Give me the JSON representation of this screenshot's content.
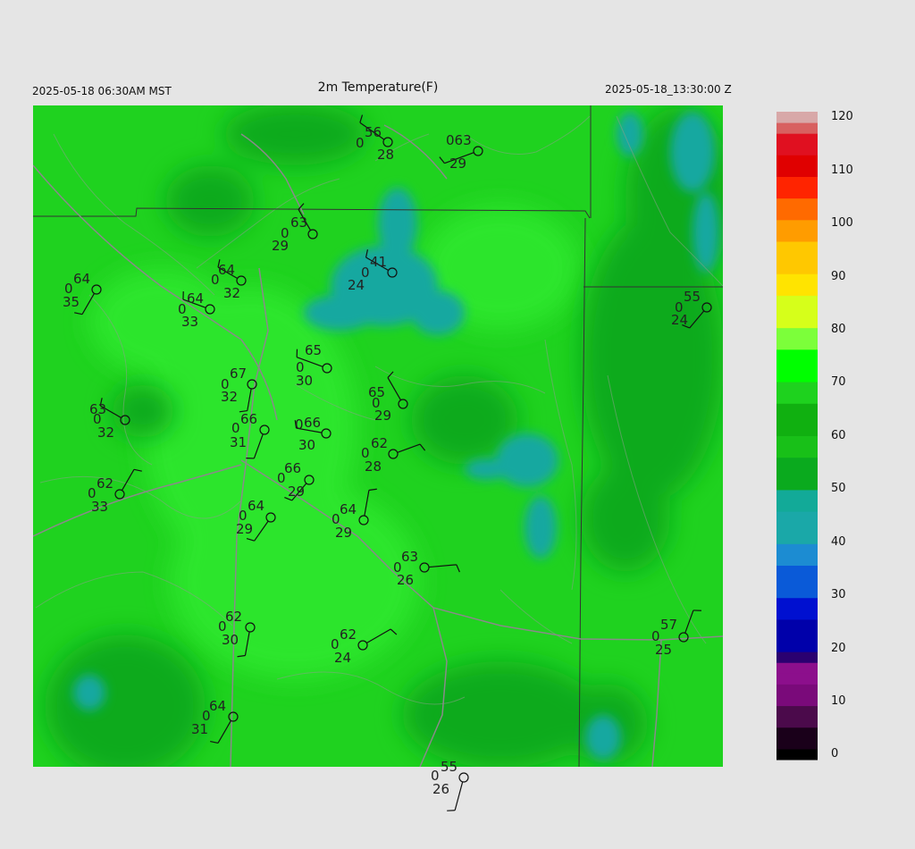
{
  "header": {
    "local_time": "2025-05-18 06:30AM MST",
    "title": "2m Temperature(F)",
    "utc_time": "2025-05-18_13:30:00 Z"
  },
  "colorbar": {
    "labels": [
      "120",
      "110",
      "100",
      "90",
      "80",
      "70",
      "60",
      "50",
      "40",
      "30",
      "20",
      "10",
      "0"
    ],
    "min": 0,
    "max": 120
  },
  "stations": [
    {
      "t": "56",
      "d": "28",
      "w": "0"
    },
    {
      "t": "063",
      "d": "29",
      "w": ""
    },
    {
      "t": "63",
      "d": "29",
      "w": "0"
    },
    {
      "t": "64",
      "d": "35",
      "w": "0"
    },
    {
      "t": "64",
      "d": "32",
      "w": "0"
    },
    {
      "t": "64",
      "d": "33",
      "w": "0"
    },
    {
      "t": "41",
      "d": "24",
      "w": "0"
    },
    {
      "t": "55",
      "d": "24",
      "w": "0"
    },
    {
      "t": "65",
      "d": "30",
      "w": "0"
    },
    {
      "t": "67",
      "d": "32",
      "w": "0"
    },
    {
      "t": "65",
      "d": "29",
      "w": "0"
    },
    {
      "t": "63",
      "d": "32",
      "w": "0"
    },
    {
      "t": "66",
      "d": "31",
      "w": "0"
    },
    {
      "t": "66",
      "d": "30",
      "w": "0"
    },
    {
      "t": "62",
      "d": "28",
      "w": "0"
    },
    {
      "t": "62",
      "d": "33",
      "w": "0"
    },
    {
      "t": "66",
      "d": "29",
      "w": "0"
    },
    {
      "t": "64",
      "d": "29",
      "w": "0"
    },
    {
      "t": "64",
      "d": "29",
      "w": "0"
    },
    {
      "t": "63",
      "d": "26",
      "w": "0"
    },
    {
      "t": "62",
      "d": "30",
      "w": "0"
    },
    {
      "t": "62",
      "d": "24",
      "w": "0"
    },
    {
      "t": "57",
      "d": "25",
      "w": "0"
    },
    {
      "t": "64",
      "d": "31",
      "w": "0"
    },
    {
      "t": "55",
      "d": "26",
      "w": "0"
    }
  ],
  "colors": {
    "background": "#e5e5e5",
    "field_base": "#1fd21f",
    "field_warm": "#28e828",
    "field_cool": "#0aaa1e",
    "field_cold": "#16a8a0"
  }
}
